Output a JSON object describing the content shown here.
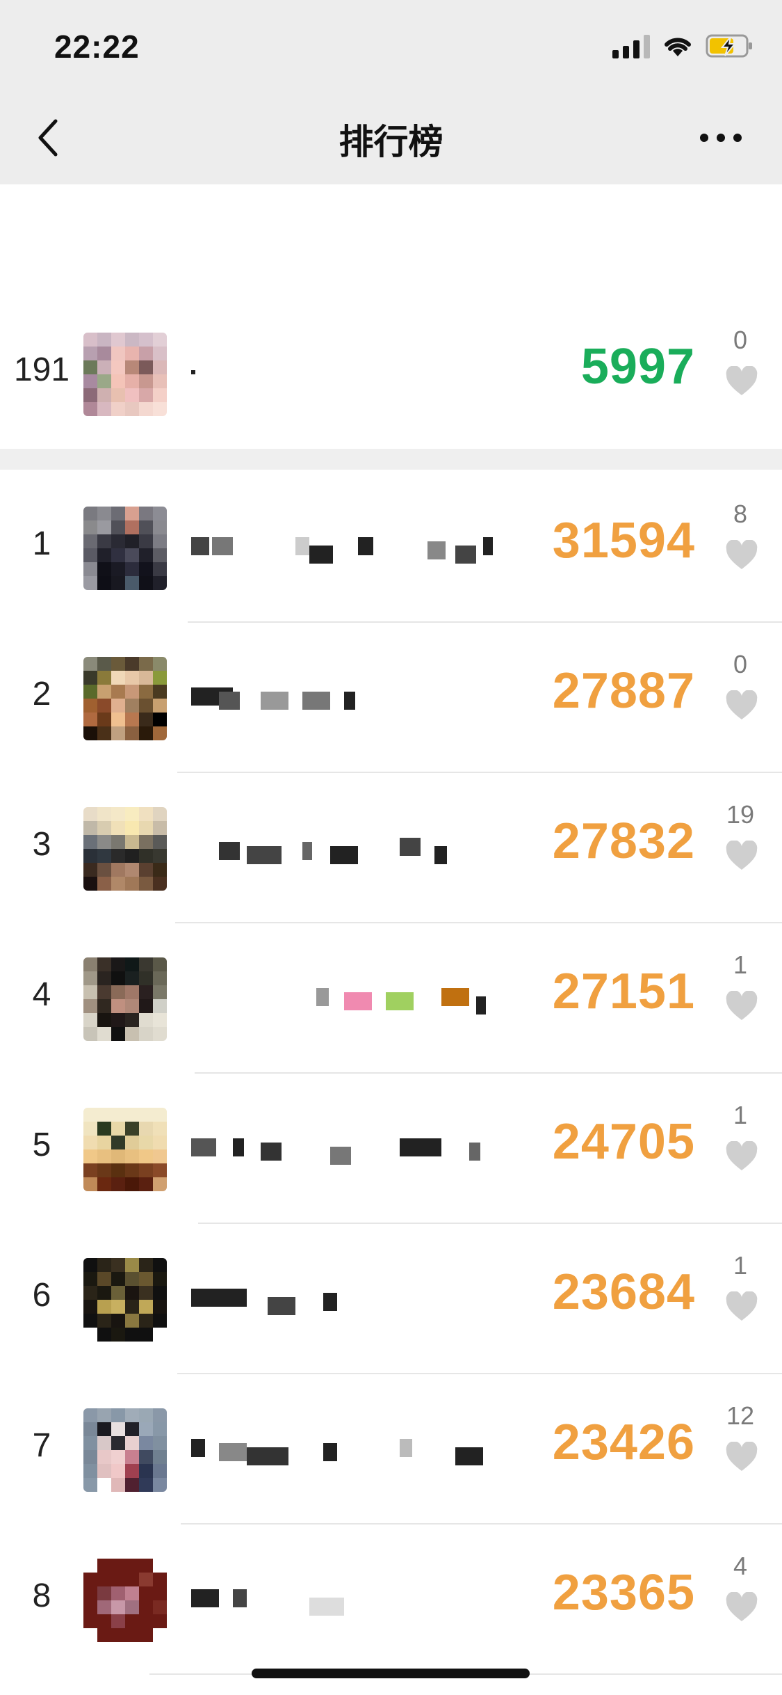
{
  "status_bar": {
    "time": "22:22"
  },
  "nav": {
    "title": "排行榜"
  },
  "my_entry": {
    "rank": "191",
    "steps": "5997",
    "likes": "0",
    "avatar_colors": [
      "#d8bfc9",
      "#c9b5c2",
      "#e0c8d0",
      "#cbb8c4",
      "#d5c0cc",
      "#e2cfd6",
      "#b8a0b0",
      "#a88a9c",
      "#f0c6c0",
      "#e8b4ae",
      "#c8a0a8",
      "#d9c0c8",
      "#6c7a5a",
      "#cbb0b8",
      "#f4c8c0",
      "#b88878",
      "#7b5a5a",
      "#dbb8b8",
      "#a88aa0",
      "#9aa888",
      "#f4c4b8",
      "#e6b0a8",
      "#c89890",
      "#e8c0b8",
      "#8c6a78",
      "#cfb0b0",
      "#e8c0b0",
      "#f0c0c0",
      "#d8a8a8",
      "#f4d0c8",
      "#b08898",
      "#d8b8c0",
      "#f0d0c8",
      "#e8c8c0",
      "#f4d8d0",
      "#f8e0d8"
    ]
  },
  "leaderboard": [
    {
      "rank": "1",
      "steps": "31594",
      "likes": "8",
      "avatar_colors": [
        "#7a7a80",
        "#8a8a90",
        "#6c6c74",
        "#d8a090",
        "#7a7880",
        "#8c8c94",
        "#8a8a8c",
        "#9a9aa0",
        "#505058",
        "#b07060",
        "#505058",
        "#8a8a90",
        "#6a6a72",
        "#3a3a44",
        "#2a2a34",
        "#202028",
        "#3a3a44",
        "#7c7c84",
        "#5a5a64",
        "#20202a",
        "#303040",
        "#4a4a5a",
        "#20202a",
        "#5c5c64",
        "#8a8a92",
        "#101018",
        "#1a1a24",
        "#2c2c3c",
        "#12121c",
        "#3a3a44",
        "#9a9aa2",
        "#0e0e16",
        "#181820",
        "#4a5a6a",
        "#101018",
        "#20202a"
      ]
    },
    {
      "rank": "2",
      "steps": "27887",
      "likes": "0",
      "avatar_colors": [
        "#8a8a7a",
        "#5a5a4a",
        "#6a5a3a",
        "#4a3a2a",
        "#7a6a4a",
        "#8a8a6a",
        "#3a3a2a",
        "#8a7a3a",
        "#f0d8b8",
        "#e8c8a8",
        "#d8b898",
        "#8a9a3a",
        "#5a6a2a",
        "#c8a070",
        "#a87a50",
        "#c89878",
        "#8a6a40",
        "#4a3a20",
        "#a06030",
        "#8a4a2a",
        "#e0b090",
        "#a08060",
        "#6a5030",
        "#c8a070",
        "#b06a40",
        "#6a3a1a",
        "#f0c090",
        "#b87850",
        "#3a2a1a",
        "#000000",
        "#1a1008",
        "#4a3018",
        "#c0a080",
        "#8a6040",
        "#2a1a0a",
        "#a0683a"
      ]
    },
    {
      "rank": "3",
      "steps": "27832",
      "likes": "19",
      "avatar_colors": [
        "#e8dcc8",
        "#f0e4c8",
        "#f4e8c8",
        "#f8ecc0",
        "#f0e0c0",
        "#e0d4c0",
        "#c0b8a8",
        "#d8ccb0",
        "#f0e0b8",
        "#f8e8b0",
        "#e8d8b0",
        "#c8bca8",
        "#6a7078",
        "#8a8a88",
        "#7a7870",
        "#c8b890",
        "#7a7060",
        "#5a5a58",
        "#2a3038",
        "#303840",
        "#2a2a2a",
        "#202020",
        "#303028",
        "#383830",
        "#3a2a20",
        "#6a5040",
        "#a07860",
        "#b08870",
        "#5a4030",
        "#3a2a18",
        "#1a1010",
        "#8a6048",
        "#b08868",
        "#a07858",
        "#7a5a40",
        "#4a3020"
      ]
    },
    {
      "rank": "4",
      "steps": "27151",
      "likes": "1",
      "avatar_colors": [
        "#8a8070",
        "#3a3028",
        "#1a1818",
        "#101818",
        "#3a3830",
        "#5a5848",
        "#a09888",
        "#2a2420",
        "#101010",
        "#1a2020",
        "#303028",
        "#6a6858",
        "#c8c0b0",
        "#4a3a30",
        "#8a6a58",
        "#a07868",
        "#2a2020",
        "#7a7868",
        "#a09080",
        "#302820",
        "#c09080",
        "#b08878",
        "#201818",
        "#d0d0c8",
        "#d8d4c8",
        "#181410",
        "#201818",
        "#2a2420",
        "#e0dcd0",
        "#e8e4d8",
        "#c8c4b8",
        "#e0dcd0",
        "#101010",
        "#c8c0b0",
        "#d8d4c8",
        "#e0dcd0"
      ]
    },
    {
      "rank": "5",
      "steps": "24705",
      "likes": "1",
      "avatar_colors": [
        "#f4ecd0",
        "#f4ecd0",
        "#f4ecd0",
        "#f4ecd0",
        "#f4ecd0",
        "#f4ecd0",
        "#f0e4c0",
        "#2a3a20",
        "#e8d8a8",
        "#3a4028",
        "#e8d8b0",
        "#f0e0b8",
        "#f0dcb0",
        "#e8d4a0",
        "#303a28",
        "#e0cc98",
        "#e8d8a8",
        "#f0dcb0",
        "#f0c888",
        "#e8c080",
        "#e0b878",
        "#e8c080",
        "#f0c888",
        "#f0c890",
        "#7a4020",
        "#6a3818",
        "#5a3010",
        "#6a3818",
        "#7a4020",
        "#8a4a28",
        "#c08a58",
        "#6a2810",
        "#5a2010",
        "#4a1808",
        "#5a2010",
        "#d0a070"
      ]
    },
    {
      "rank": "6",
      "steps": "23684",
      "likes": "1",
      "avatar_colors": [
        "#101010",
        "#2a2418",
        "#3a3020",
        "#9a8a48",
        "#2a2418",
        "#101010",
        "#1a1810",
        "#5a4828",
        "#1a1810",
        "#5a5030",
        "#6a5830",
        "#1a1810",
        "#2a2418",
        "#1a1810",
        "#6a6038",
        "#1a1410",
        "#3a3020",
        "#101010",
        "#181410",
        "#b8a050",
        "#c8b060",
        "#2a2418",
        "#c0a858",
        "#181410",
        "#101010",
        "#2a2418",
        "#181410",
        "#8a7840",
        "#2a2418",
        "#101010",
        "#ffffff",
        "#101010",
        "#1a1810",
        "#101010",
        "#101010",
        "#ffffff"
      ]
    },
    {
      "rank": "7",
      "steps": "23426",
      "likes": "12",
      "avatar_colors": [
        "#8a98a8",
        "#98a4b0",
        "#8898a8",
        "#a0acb8",
        "#9aa8b4",
        "#8a98a8",
        "#7a8898",
        "#1a1a20",
        "#e8e0e0",
        "#202028",
        "#9aa8b8",
        "#8898a8",
        "#8090a0",
        "#d8c8c8",
        "#2a2a30",
        "#e8d0d0",
        "#7a88a0",
        "#8090a0",
        "#7a8898",
        "#e8c8c8",
        "#f0d0d0",
        "#c88090",
        "#404a60",
        "#708090",
        "#8090a0",
        "#e0c0c0",
        "#f0c8c8",
        "#a04050",
        "#2a3450",
        "#6a7890",
        "#8898a8",
        "#ffffff",
        "#e0b8b8",
        "#502030",
        "#303a58",
        "#7a88a0"
      ]
    },
    {
      "rank": "8",
      "steps": "23365",
      "likes": "4",
      "avatar_colors": [
        "#ffffff",
        "#6a1a14",
        "#6a1a14",
        "#6a1a14",
        "#6a1a14",
        "#ffffff",
        "#6a1a14",
        "#6a1a14",
        "#6a1a14",
        "#6a1a14",
        "#8a3a30",
        "#6a1a14",
        "#6a1a14",
        "#7a3a40",
        "#a06070",
        "#c08090",
        "#6a1a14",
        "#6a1a14",
        "#6a1a14",
        "#a06878",
        "#c898a8",
        "#a07080",
        "#6a1a14",
        "#7a2a22",
        "#6a1a14",
        "#6a1a14",
        "#8a4048",
        "#6a1a14",
        "#6a1a14",
        "#6a1a14",
        "#ffffff",
        "#6a1a14",
        "#6a1a14",
        "#6a1a14",
        "#6a1a14",
        "#ffffff"
      ]
    }
  ]
}
